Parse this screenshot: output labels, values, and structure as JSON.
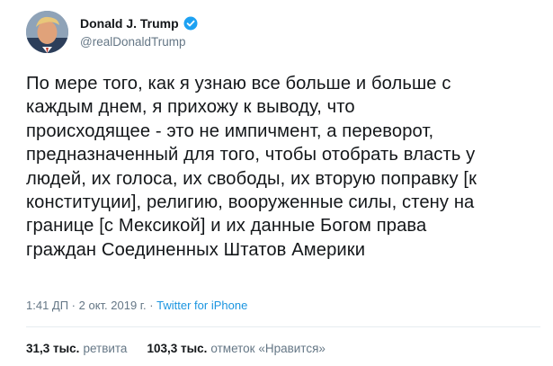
{
  "author": {
    "display_name": "Donald J. Trump",
    "handle": "@realDonaldTrump",
    "verified_icon": "verified-badge-icon",
    "avatar_icon": "avatar-photo"
  },
  "tweet": {
    "lines": [
      "По мере того, как я узнаю все больше и больше с",
      "каждым днем, я прихожу к выводу, что",
      "происходящее - это не импичмент, а переворот,",
      "предназначенный для того, чтобы отобрать власть у",
      "людей, их голоса, их свободы, их вторую поправку [к",
      "конституции], религию, вооруженные силы, стену на",
      "границе [с Мексикой] и их данные Богом права",
      "граждан Соединенных Штатов Америки"
    ]
  },
  "meta": {
    "time": "1:41 ДП",
    "sep1": " · ",
    "date": "2 окт. 2019 г.",
    "sep2": " · ",
    "source": "Twitter for iPhone"
  },
  "stats": {
    "retweets_count": "31,3 тыс.",
    "retweets_label": "ретвита",
    "likes_count": "103,3 тыс.",
    "likes_label": "отметок «Нравится»"
  },
  "colors": {
    "text": "#14171a",
    "secondary": "#657786",
    "link": "#1b95e0",
    "verified": "#1da1f2"
  }
}
